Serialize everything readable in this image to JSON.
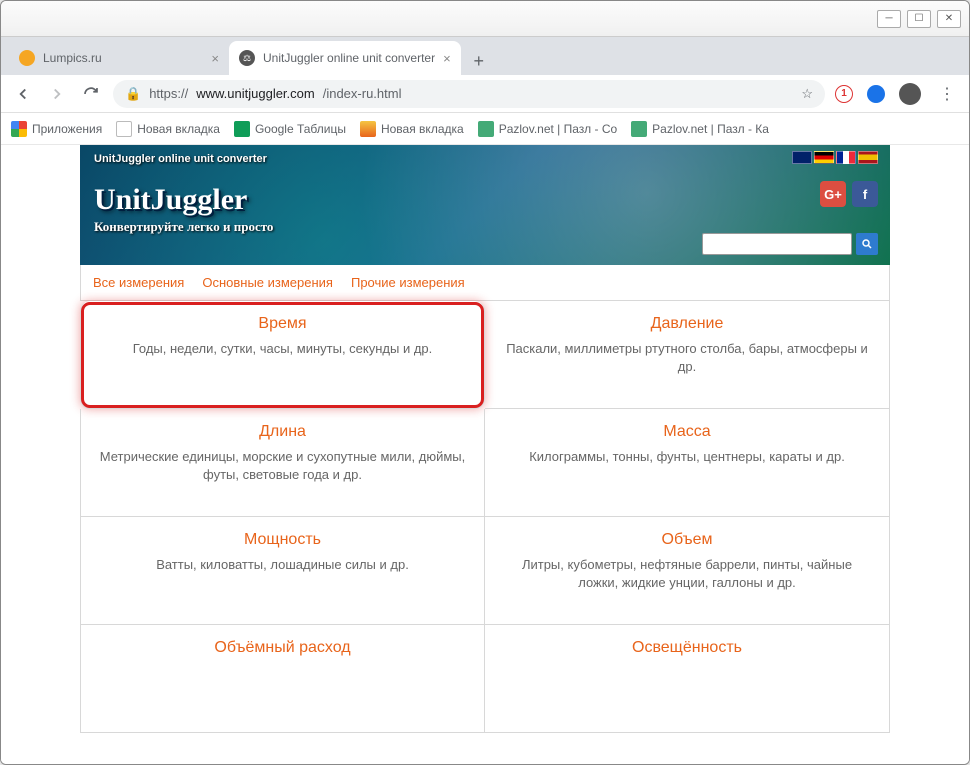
{
  "window": {
    "tabs": [
      {
        "title": "Lumpics.ru",
        "icon_color": "#f5a623"
      },
      {
        "title": "UnitJuggler online unit converter",
        "icon_color": "#555"
      }
    ]
  },
  "nav": {
    "url_prefix": "https://",
    "url_host": "www.unitjuggler.com",
    "url_path": "/index-ru.html"
  },
  "bookmarks": [
    {
      "label": "Приложения",
      "icon": "apps"
    },
    {
      "label": "Новая вкладка",
      "icon": "page"
    },
    {
      "label": "Google Таблицы",
      "icon": "sheets"
    },
    {
      "label": "Новая вкладка",
      "icon": "img"
    },
    {
      "label": "Pazlov.net | Пазл - Со",
      "icon": "puzzle"
    },
    {
      "label": "Pazlov.net | Пазл - Ка",
      "icon": "puzzle"
    }
  ],
  "banner": {
    "top_text": "UnitJuggler online unit converter",
    "logo": "UnitJuggler",
    "tagline": "Конвертируйте легко и просто"
  },
  "search": {
    "placeholder": ""
  },
  "menu": [
    "Все измерения",
    "Основные измерения",
    "Прочие измерения"
  ],
  "cards": [
    {
      "title": "Время",
      "desc": "Годы, недели, сутки, часы, минуты, секунды и др.",
      "highlight": true
    },
    {
      "title": "Давление",
      "desc": "Паскали, миллиметры ртутного столба, бары, атмосферы и др."
    },
    {
      "title": "Длина",
      "desc": "Метрические единицы, морские и сухопутные мили, дюймы, футы, световые года и др."
    },
    {
      "title": "Масса",
      "desc": "Килограммы, тонны, фунты, центнеры, караты и др."
    },
    {
      "title": "Мощность",
      "desc": "Ватты, киловатты, лошадиные силы и др."
    },
    {
      "title": "Объем",
      "desc": "Литры, кубометры, нефтяные баррели, пинты, чайные ложки, жидкие унции, галлоны и др."
    },
    {
      "title": "Объёмный расход",
      "desc": ""
    },
    {
      "title": "Освещённость",
      "desc": ""
    }
  ]
}
